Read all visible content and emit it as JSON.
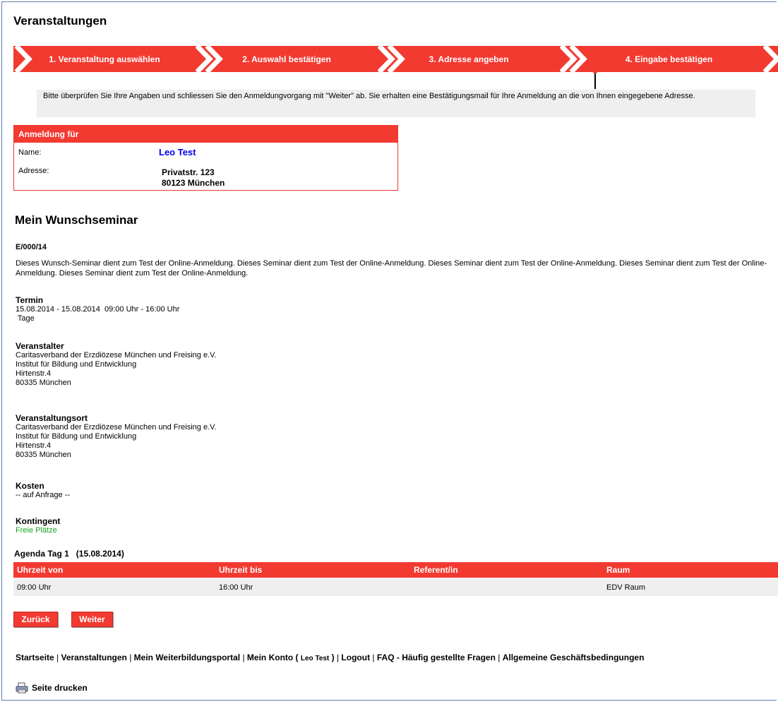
{
  "page_title": "Veranstaltungen",
  "steps": [
    {
      "label": "1. Veranstaltung auswählen"
    },
    {
      "label": "2. Auswahl bestätigen"
    },
    {
      "label": "3. Adresse angeben"
    },
    {
      "label": "4. Eingabe bestätigen"
    }
  ],
  "info_text": "Bitte überprüfen Sie Ihre Angaben und schliessen Sie den Anmeldungvorgang mit \"Weiter\" ab. Sie erhalten eine Bestätigungsmail für Ihre Anmeldung an die von Ihnen eingegebene Adresse.",
  "registration": {
    "header": "Anmeldung für",
    "name_label": "Name:",
    "name_value": "Leo Test",
    "address_label": "Adresse:",
    "address_line1": "Privatstr. 123",
    "address_line2": "80123 München"
  },
  "seminar": {
    "title": "Mein Wunschseminar",
    "code": "E/000/14",
    "description": "Dieses Wunsch-Seminar dient zum Test der Online-Anmeldung. Dieses Seminar dient zum Test der Online-Anmeldung. Dieses Seminar dient zum Test der Online-Anmeldung. Dieses Seminar dient zum Test der Online-Anmeldung. Dieses Seminar dient zum Test der Online-Anmeldung.",
    "termin_label": "Termin",
    "termin_line1": "15.08.2014 - 15.08.2014  09:00 Uhr - 16:00 Uhr",
    "termin_line2": " Tage",
    "veranstalter_label": "Veranstalter",
    "veranstalter_lines": [
      "Caritasverband der Erzdiözese München und Freising e.V.",
      "Institut für Bildung und Entwicklung",
      "Hirtenstr.4",
      "80335 München"
    ],
    "ort_label": "Veranstaltungsort",
    "ort_lines": [
      "Caritasverband der Erzdiözese München und Freising e.V.",
      "Institut für Bildung und Entwicklung",
      "Hirtenstr.4",
      "80335 München"
    ],
    "kosten_label": "Kosten",
    "kosten_value": "-- auf Anfrage --",
    "kontingent_label": "Kontingent",
    "kontingent_value": "Freie Plätze"
  },
  "agenda": {
    "title": "Agenda Tag 1   (15.08.2014)",
    "columns": [
      "Uhrzeit von",
      "Uhrzeit bis",
      "Referent/in",
      "Raum"
    ],
    "rows": [
      [
        "09:00 Uhr",
        "16:00 Uhr",
        "",
        "EDV Raum"
      ]
    ]
  },
  "buttons": {
    "back": "Zurück",
    "next": "Weiter"
  },
  "footer": {
    "links": [
      "Startseite",
      "Veranstaltungen",
      "Mein Weiterbildungsportal",
      "Mein Konto ( ",
      "Leo Test",
      " )",
      "Logout",
      "FAQ - Häufig gestellte Fragen",
      "Allgemeine Geschäftsbedingungen"
    ],
    "print_label": "Seite drucken"
  },
  "colors": {
    "accent": "#f23a31",
    "link": "#0000ee",
    "green": "#18a31e",
    "panel": "#efefef"
  }
}
